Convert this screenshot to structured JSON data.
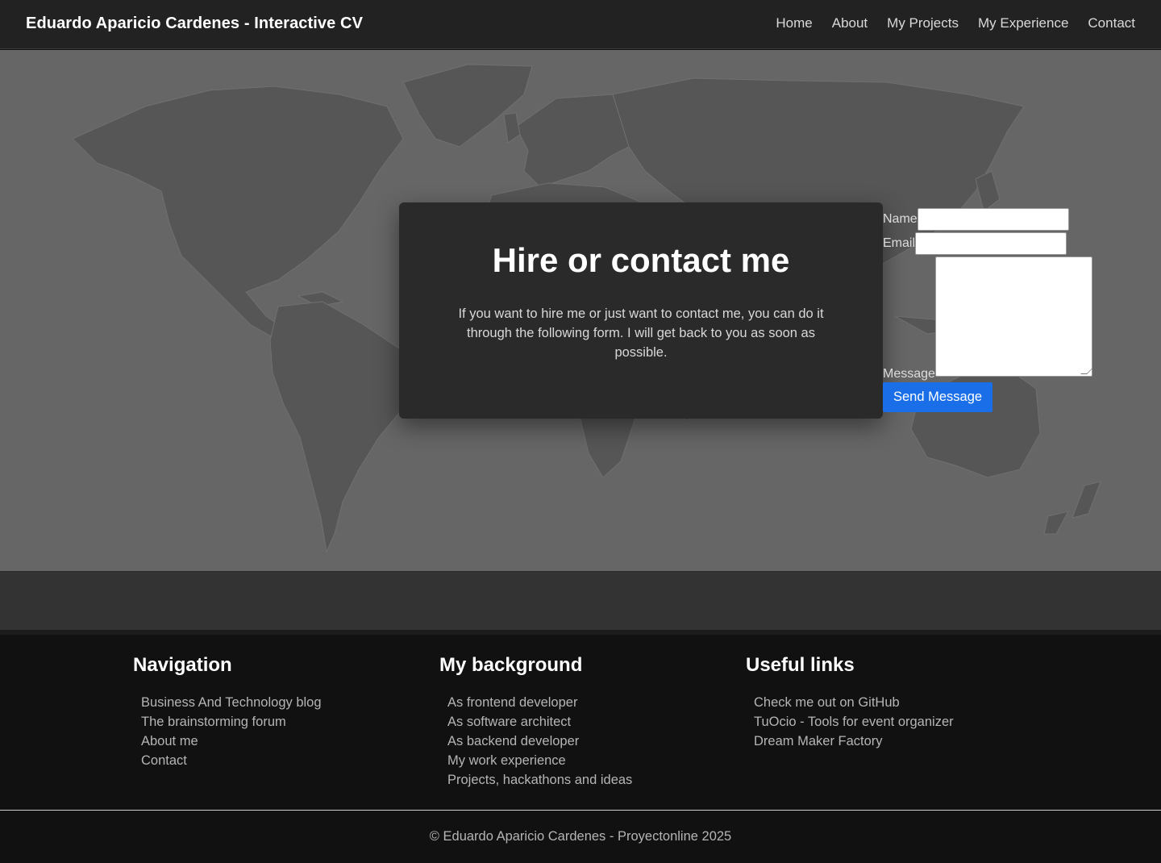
{
  "header": {
    "brand": "Eduardo Aparicio Cardenes - Interactive CV",
    "nav": [
      "Home",
      "About",
      "My Projects",
      "My Experience",
      "Contact"
    ]
  },
  "hero": {
    "title": "Hire or contact me",
    "description": "If you want to hire me or just want to contact me, you can do it through the following form. I will get back to you as soon as possible."
  },
  "form": {
    "name_label": "Name",
    "name_value": "",
    "email_label": "Email",
    "email_value": "",
    "message_label": "Message",
    "message_value": "",
    "send_label": "Send Message"
  },
  "footer": {
    "columns": [
      {
        "title": "Navigation",
        "links": [
          "Business And Technology blog",
          "The brainstorming forum",
          "About me",
          "Contact"
        ]
      },
      {
        "title": "My background",
        "links": [
          "As frontend developer",
          "As software architect",
          "As backend developer",
          "My work experience",
          "Projects, hackathons and ideas"
        ]
      },
      {
        "title": "Useful links",
        "links": [
          "Check me out on GitHub",
          "TuOcio - Tools for event organizer",
          "Dream Maker Factory"
        ]
      }
    ],
    "copyright": "© Eduardo Aparicio Cardenes - Proyectonline 2025"
  },
  "colors": {
    "topbar": "#222222",
    "hero_bg": "#666666",
    "continent": "#555555",
    "card": "#2a2a2a",
    "button": "#1a6fe8",
    "footer": "#111111"
  }
}
